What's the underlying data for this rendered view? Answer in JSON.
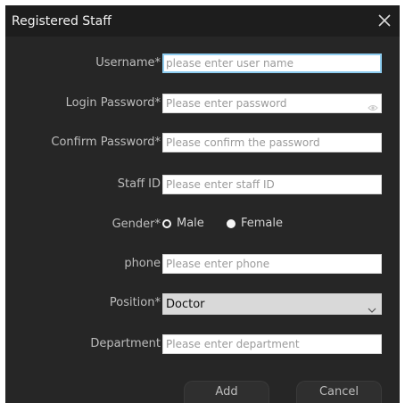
{
  "dialog": {
    "title": "Registered Staff",
    "close_icon": "close-icon"
  },
  "form": {
    "username": {
      "label": "Username*",
      "value": "",
      "placeholder": "please enter user name",
      "focused": true
    },
    "login_password": {
      "label": "Login Password*",
      "value": "",
      "placeholder": "Please enter password",
      "icon": "eye-icon"
    },
    "confirm_password": {
      "label": "Confirm Password*",
      "value": "",
      "placeholder": "Please confirm the password"
    },
    "staff_id": {
      "label": "Staff ID",
      "value": "",
      "placeholder": "Please enter staff ID"
    },
    "gender": {
      "label": "Gender*",
      "options": [
        {
          "label": "Male",
          "selected": true
        },
        {
          "label": "Female",
          "selected": false
        }
      ]
    },
    "phone": {
      "label": "phone",
      "value": "",
      "placeholder": "Please enter phone"
    },
    "position": {
      "label": "Position*",
      "selected": "Doctor",
      "icon": "chevron-down-icon"
    },
    "department": {
      "label": "Department",
      "value": "",
      "placeholder": "Please enter department"
    }
  },
  "buttons": {
    "add_label": "Add",
    "cancel_label": "Cancel"
  },
  "colors": {
    "dialog_bg": "#262626",
    "titlebar_bg": "#1d1d1d",
    "focus_border": "#8ecdf0",
    "select_bg": "#d9d9d9"
  }
}
